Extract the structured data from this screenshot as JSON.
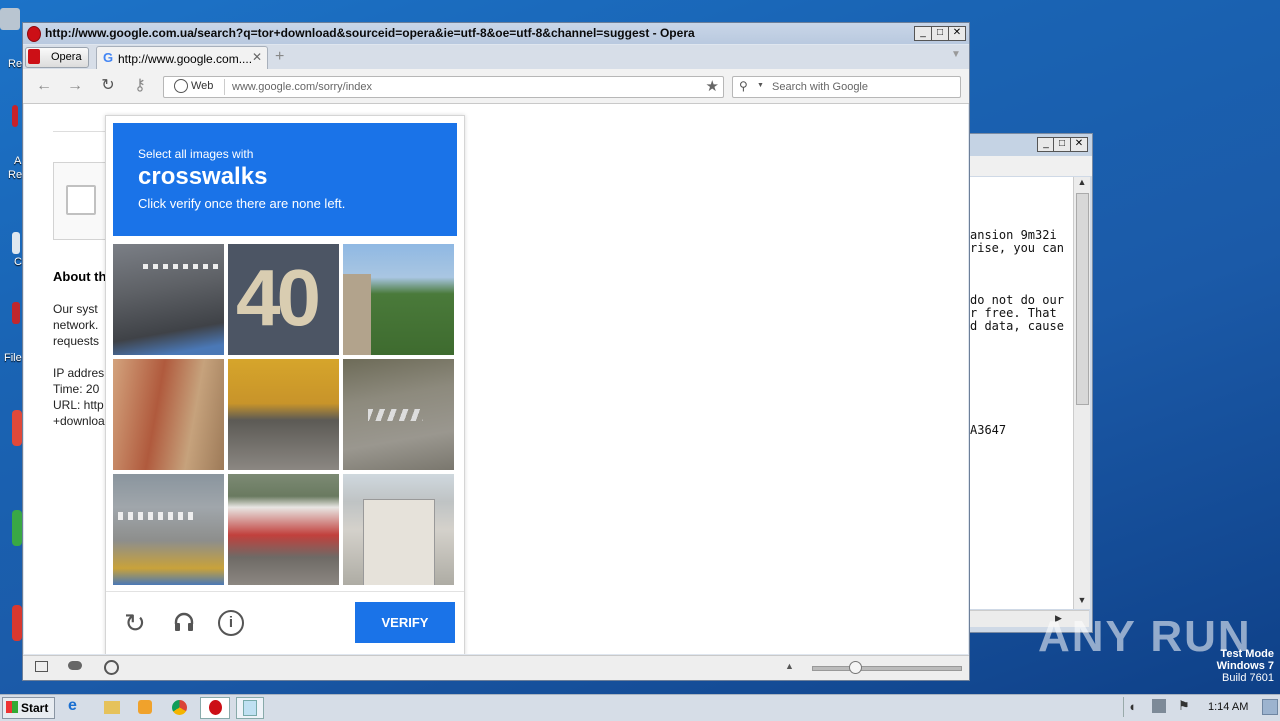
{
  "desktop": {
    "icon_labels": [
      "Re",
      "A",
      "Re",
      "C",
      "File"
    ],
    "watermark": {
      "brand": "ANY RUN",
      "line1": "Test Mode",
      "line2": "Windows 7",
      "line3": "Build 7601"
    }
  },
  "notepad": {
    "lines": [
      "ansion 9m32i",
      "rise, you can",
      "do not do our",
      "r free. That",
      "d data, cause",
      "A3647"
    ]
  },
  "browser": {
    "title": "http://www.google.com.ua/search?q=tor+download&sourceid=opera&ie=utf-8&oe=utf-8&channel=suggest - Opera",
    "menu_label": "Opera",
    "tab_label": "http://www.google.com....",
    "search_engine_label": "Web",
    "address": "www.google.com/sorry/index",
    "search_placeholder": "Search with Google"
  },
  "page": {
    "about_heading": "About th",
    "body_lines": [
      "Our syst",
      "network.",
      "requests"
    ],
    "info_lines": [
      "IP addres",
      "Time: 20",
      "URL: http",
      "+downloa"
    ]
  },
  "captcha": {
    "instruction_top": "Select all images with",
    "target": "crosswalks",
    "instruction_bottom": "Click verify once there are none left.",
    "verify_label": "VERIFY",
    "tile_40_text": "40"
  },
  "taskbar": {
    "start_label": "Start",
    "clock": "1:14 AM"
  }
}
